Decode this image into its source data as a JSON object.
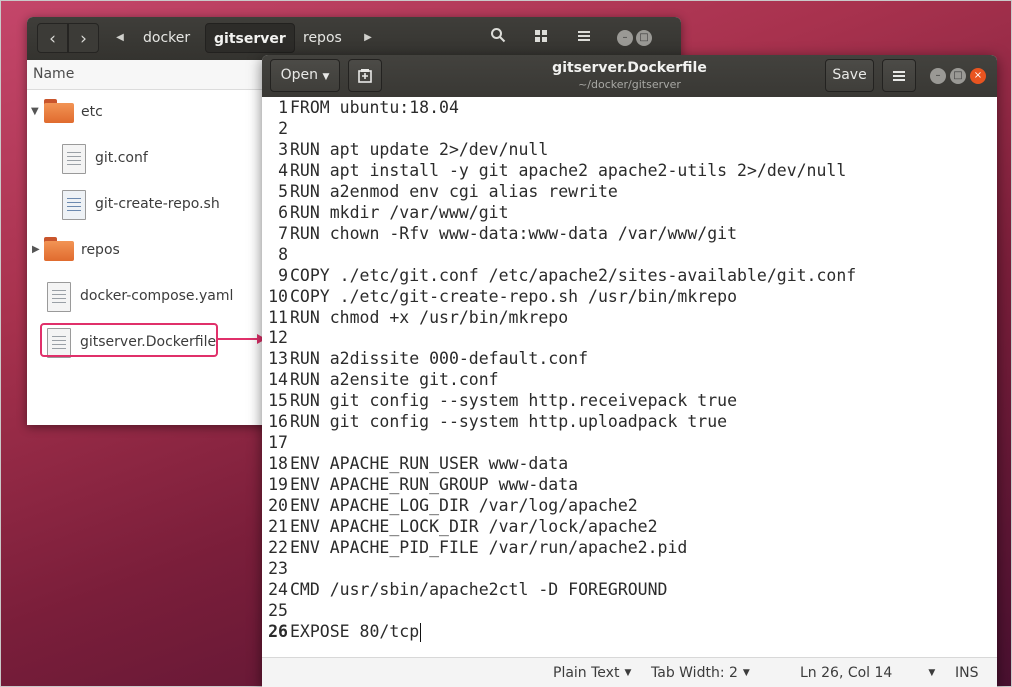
{
  "file_manager": {
    "breadcrumbs": [
      "docker",
      "gitserver",
      "repos"
    ],
    "active_crumb": "gitserver",
    "column_header": "Name",
    "items": [
      {
        "label": "etc",
        "kind": "folder",
        "expanded": true,
        "level": 0
      },
      {
        "label": "git.conf",
        "kind": "text-file",
        "level": 1
      },
      {
        "label": "git-create-repo.sh",
        "kind": "script-file",
        "level": 1
      },
      {
        "label": "repos",
        "kind": "folder",
        "expanded": false,
        "level": 0
      },
      {
        "label": "docker-compose.yaml",
        "kind": "text-file",
        "level": 0
      },
      {
        "label": "gitserver.Dockerfile",
        "kind": "text-file",
        "level": 0,
        "highlighted": true
      }
    ]
  },
  "editor": {
    "open_label": "Open",
    "save_label": "Save",
    "title": "gitserver.Dockerfile",
    "subtitle": "~/docker/gitserver",
    "lines": [
      {
        "n": "1",
        "text": "FROM ubuntu:18.04"
      },
      {
        "n": "2",
        "text": ""
      },
      {
        "n": "3",
        "text": "RUN apt update 2>/dev/null"
      },
      {
        "n": "4",
        "text": "RUN apt install -y git apache2 apache2-utils 2>/dev/null"
      },
      {
        "n": "5",
        "text": "RUN a2enmod env cgi alias rewrite"
      },
      {
        "n": "6",
        "text": "RUN mkdir /var/www/git"
      },
      {
        "n": "7",
        "text": "RUN chown -Rfv www-data:www-data /var/www/git"
      },
      {
        "n": "8",
        "text": ""
      },
      {
        "n": "9",
        "text": "COPY ./etc/git.conf /etc/apache2/sites-available/git.conf"
      },
      {
        "n": "10",
        "text": "COPY ./etc/git-create-repo.sh /usr/bin/mkrepo"
      },
      {
        "n": "11",
        "text": "RUN chmod +x /usr/bin/mkrepo"
      },
      {
        "n": "12",
        "text": ""
      },
      {
        "n": "13",
        "text": "RUN a2dissite 000-default.conf"
      },
      {
        "n": "14",
        "text": "RUN a2ensite git.conf"
      },
      {
        "n": "15",
        "text": "RUN git config --system http.receivepack true"
      },
      {
        "n": "16",
        "text": "RUN git config --system http.uploadpack true"
      },
      {
        "n": "17",
        "text": ""
      },
      {
        "n": "18",
        "text": "ENV APACHE_RUN_USER www-data"
      },
      {
        "n": "19",
        "text": "ENV APACHE_RUN_GROUP www-data"
      },
      {
        "n": "20",
        "text": "ENV APACHE_LOG_DIR /var/log/apache2"
      },
      {
        "n": "21",
        "text": "ENV APACHE_LOCK_DIR /var/lock/apache2"
      },
      {
        "n": "22",
        "text": "ENV APACHE_PID_FILE /var/run/apache2.pid"
      },
      {
        "n": "23",
        "text": ""
      },
      {
        "n": "24",
        "text": "CMD /usr/sbin/apache2ctl -D FOREGROUND"
      },
      {
        "n": "25",
        "text": ""
      },
      {
        "n": "26",
        "text": "EXPOSE 80/tcp"
      }
    ],
    "current_line": "26",
    "status": {
      "language": "Plain Text",
      "tab_width": "Tab Width: 2",
      "position": "Ln 26, Col 14",
      "mode": "INS"
    }
  },
  "colors": {
    "highlight": "#e0306a",
    "folder": "#f0853f",
    "close_button": "#e95420"
  }
}
